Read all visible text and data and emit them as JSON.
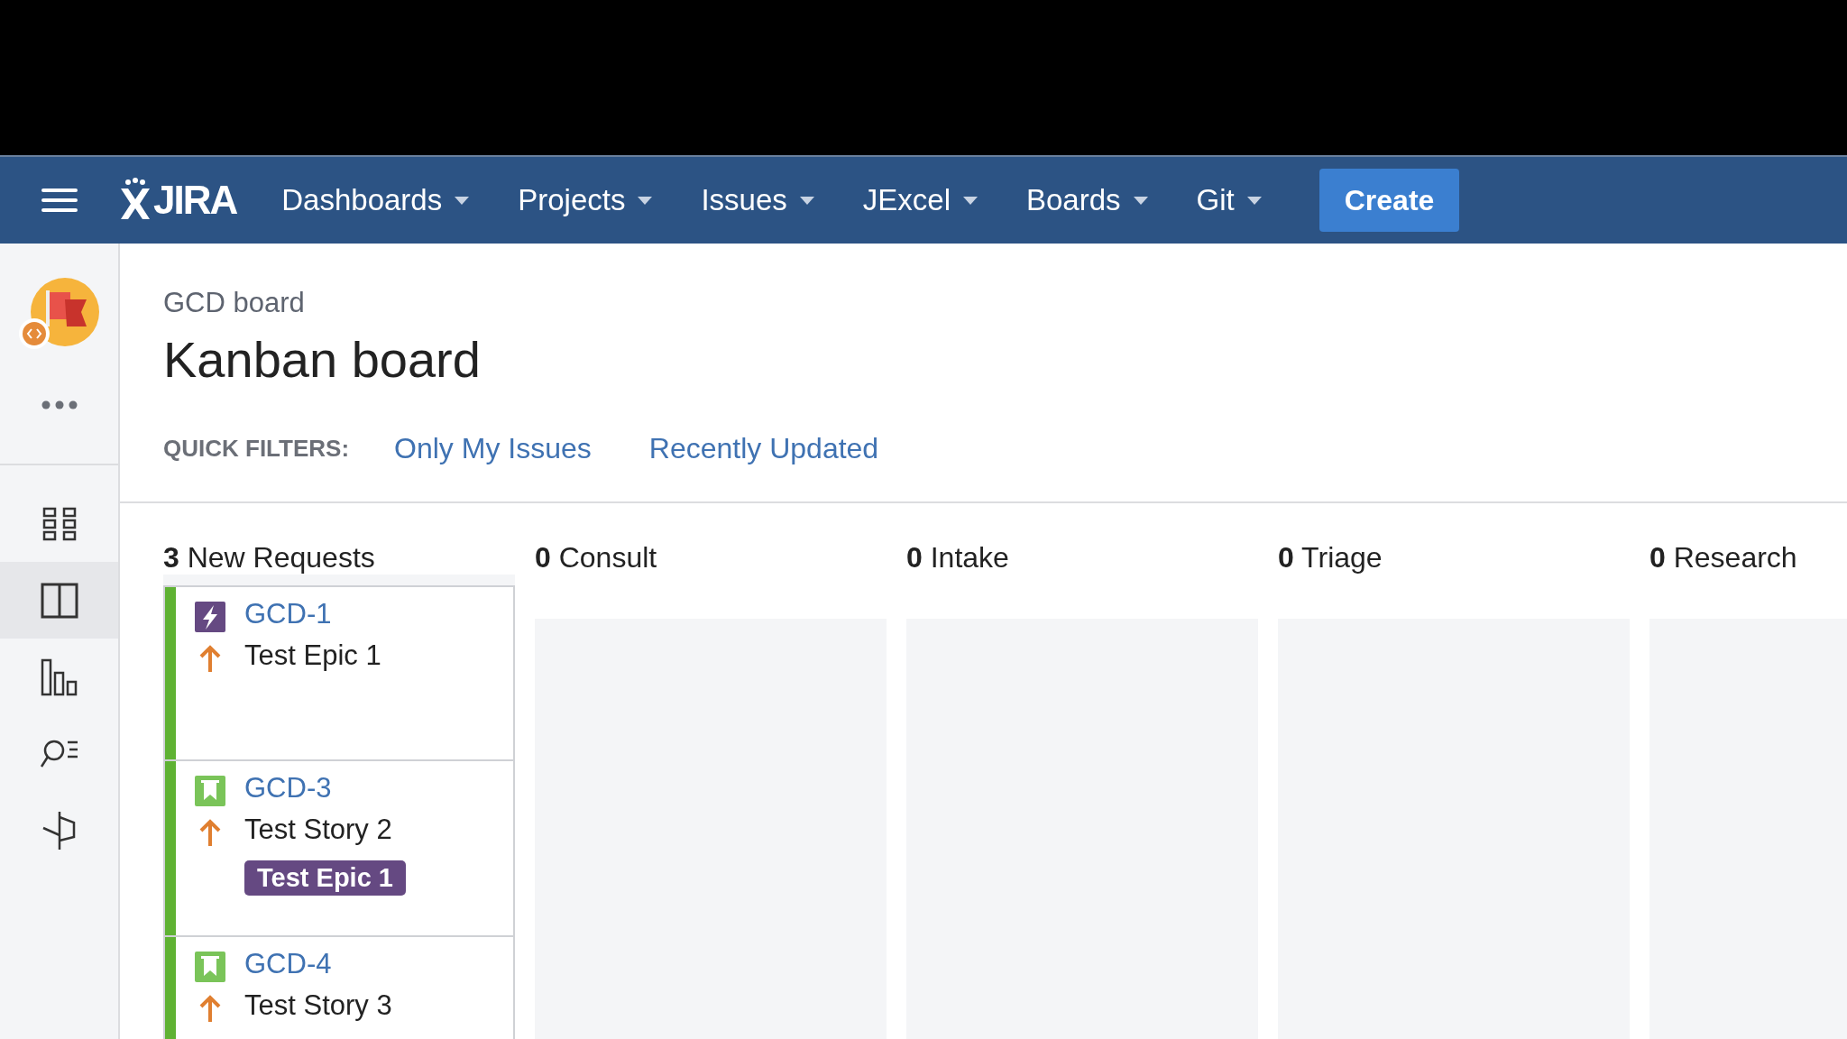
{
  "header": {
    "logo": "JIRA",
    "nav": [
      {
        "label": "Dashboards"
      },
      {
        "label": "Projects"
      },
      {
        "label": "Issues"
      },
      {
        "label": "JExcel"
      },
      {
        "label": "Boards"
      },
      {
        "label": "Git"
      }
    ],
    "create": "Create"
  },
  "sidebar": {
    "items": [
      {
        "kind": "grid",
        "selected": false
      },
      {
        "kind": "board",
        "selected": true
      },
      {
        "kind": "reports",
        "selected": false
      },
      {
        "kind": "search",
        "selected": false
      },
      {
        "kind": "releases",
        "selected": false
      }
    ]
  },
  "breadcrumb": "GCD board",
  "title": "Kanban board",
  "quick_filters": {
    "label": "QUICK FILTERS:",
    "filters": [
      "Only My Issues",
      "Recently Updated"
    ]
  },
  "columns": [
    {
      "count": "3",
      "name": "New Requests",
      "cards": [
        {
          "kind": "epic",
          "key": "GCD-1",
          "summary": "Test Epic 1"
        },
        {
          "kind": "story",
          "key": "GCD-3",
          "summary": "Test Story 2",
          "epic": "Test Epic 1"
        },
        {
          "kind": "story",
          "key": "GCD-4",
          "summary": "Test Story 3"
        }
      ]
    },
    {
      "count": "0",
      "name": "Consult"
    },
    {
      "count": "0",
      "name": "Intake"
    },
    {
      "count": "0",
      "name": "Triage"
    },
    {
      "count": "0",
      "name": "Research"
    }
  ]
}
